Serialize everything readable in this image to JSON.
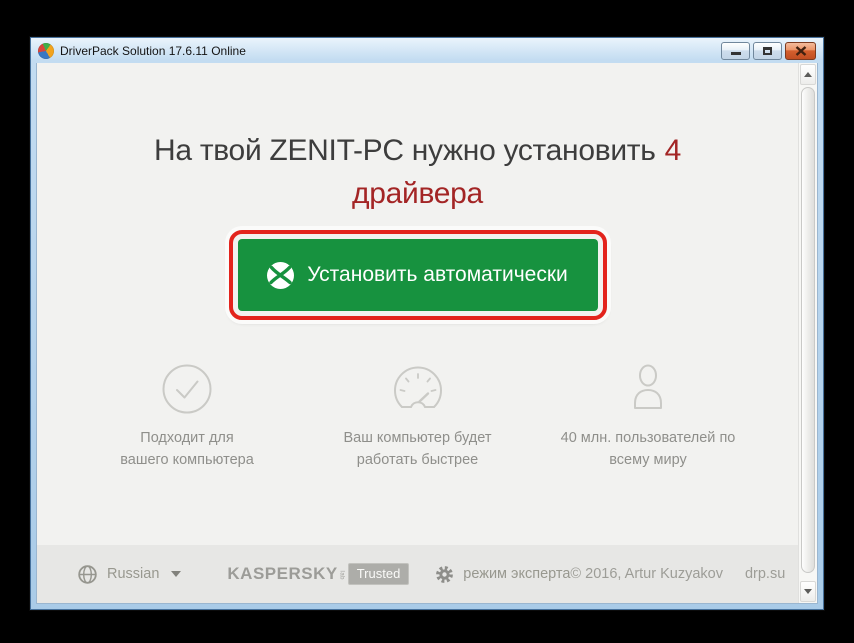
{
  "window": {
    "title": "DriverPack Solution 17.6.11 Online"
  },
  "heading": {
    "prefix": "На твой ZENIT-PC нужно установить",
    "count": "4",
    "suffix": "драйвера",
    "accent_color": "#a32525"
  },
  "install": {
    "label": "Установить автоматически",
    "button_color": "#17923f",
    "highlight_color": "#e3241d"
  },
  "features": [
    {
      "icon": "check-circle-icon",
      "line1": "Подходит для",
      "line2": "вашего компьютера"
    },
    {
      "icon": "speedometer-icon",
      "line1": "Ваш компьютер будет",
      "line2": "работать быстрее"
    },
    {
      "icon": "user-icon",
      "line1": "40 млн. пользователей по",
      "line2": "всему миру"
    }
  ],
  "footer": {
    "language": "Russian",
    "kaspersky": "KASPERSKY",
    "kaspersky_lab": "lab",
    "trusted": "Trusted",
    "expert_mode": "режим эксперта",
    "copyright": "© 2016, Artur Kuzyakov",
    "site": "drp.su"
  }
}
